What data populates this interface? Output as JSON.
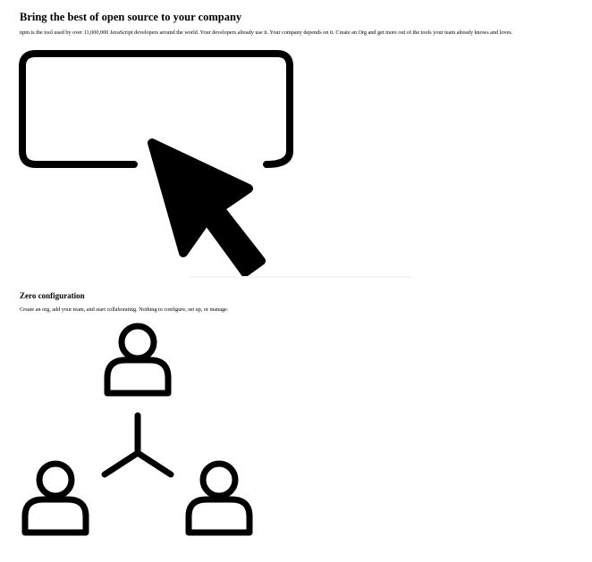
{
  "sections": [
    {
      "title": "Bring the best of open source to your company",
      "description": "npm is the tool used by over 11,000,000 JavaScript developers around the world. Your developers already use it. Your company depends on it. Create an Org and get more out of the tools your team already knows and loves.",
      "illustration": "cursor-click-icon"
    },
    {
      "title": "Zero configuration",
      "description": "Create an org, add your team, and start collaborating. Nothing to configure, set up, or manage.",
      "illustration": "team-network-icon"
    }
  ],
  "colors": {
    "background": "#ffffff",
    "text": "#000000",
    "icon_stroke": "#000000"
  }
}
